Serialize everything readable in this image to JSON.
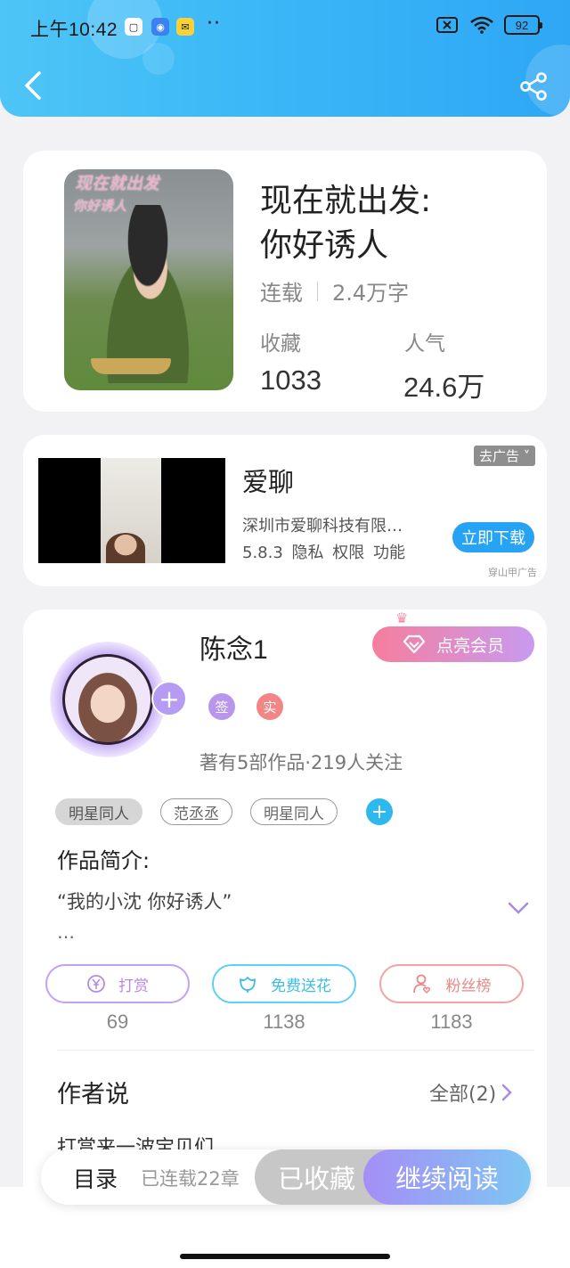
{
  "status_bar": {
    "time": "上午10:42",
    "more": "··",
    "battery": "92"
  },
  "book": {
    "cover_text_line1": "现在就出发",
    "cover_text_line2": "你好诱人",
    "title_line1": "现在就出发:",
    "title_line2": "你好诱人",
    "status": "连载",
    "word_count": "2.4万字",
    "favorites_label": "收藏",
    "favorites_value": "1033",
    "popularity_label": "人气",
    "popularity_value": "24.6万"
  },
  "ad": {
    "remove_label": "去广告",
    "app_name": "爱聊",
    "company": "深圳市爱聊科技有限…",
    "info": "5.8.3 隐私 权限 功能",
    "download_label": "立即下载",
    "source": "穿山甲广告"
  },
  "author": {
    "name": "陈念1",
    "vip_button": "点亮会员",
    "badge_sign": "签",
    "badge_real": "实",
    "stats": "著有5部作品·219人关注",
    "tags": [
      "明星同人",
      "范丞丞",
      "明星同人"
    ],
    "intro_label": "作品简介:",
    "intro_text": "“我的小沈 你好诱人”",
    "intro_more": "…",
    "actions": [
      {
        "label": "打赏",
        "count": "69"
      },
      {
        "label": "免费送花",
        "count": "1138"
      },
      {
        "label": "粉丝榜",
        "count": "1183"
      }
    ],
    "author_says_label": "作者说",
    "all_label": "全部(2)",
    "author_says_text": "打赏来一波宝贝们"
  },
  "bottom_bar": {
    "toc_label": "目录",
    "toc_count": "已连载22章",
    "collected_label": "已收藏",
    "continue_label": "继续阅读"
  },
  "colors": {
    "header": "#39b6f7",
    "accent_purple": "#b59bf1",
    "accent_pink": "#f67e9d"
  }
}
